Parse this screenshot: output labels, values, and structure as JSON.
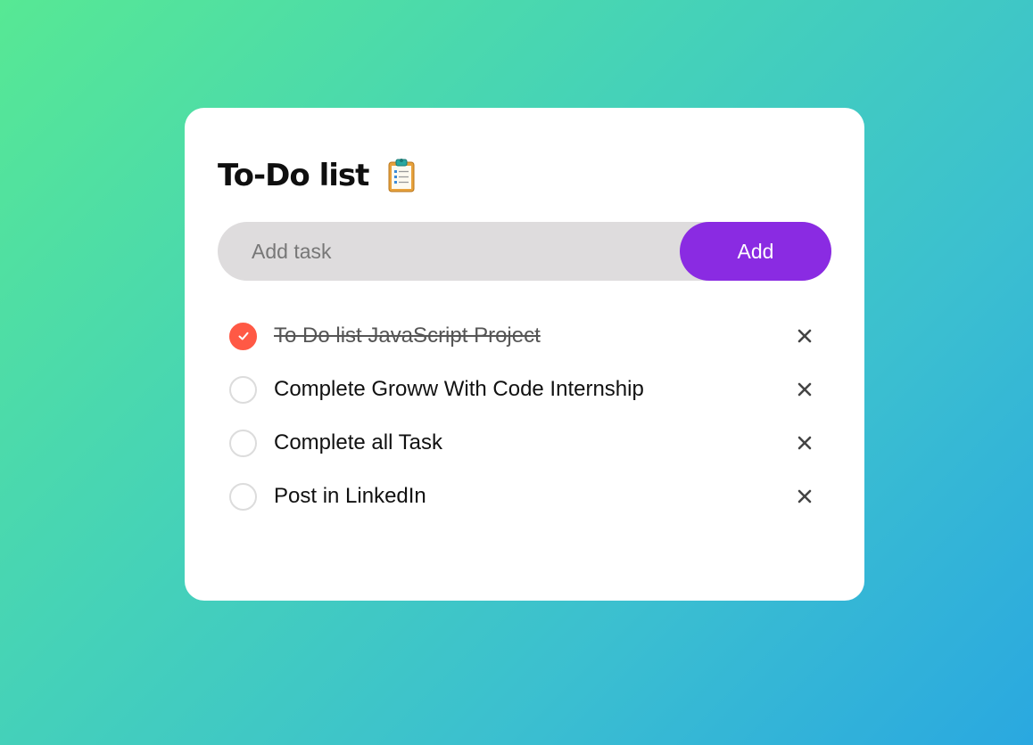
{
  "app": {
    "title": "To-Do list",
    "title_icon": "clipboard-icon"
  },
  "input": {
    "placeholder": "Add task",
    "value": ""
  },
  "add_button": {
    "label": "Add"
  },
  "colors": {
    "accent": "#8a2be2",
    "checked": "#ff5945",
    "input_bg": "#dedcdd"
  },
  "tasks": [
    {
      "text": "To Do list JavaScript Project",
      "done": true
    },
    {
      "text": "Complete Groww With Code Internship",
      "done": false
    },
    {
      "text": "Complete all Task",
      "done": false
    },
    {
      "text": "Post in LinkedIn",
      "done": false
    }
  ],
  "icons": {
    "check": "check-icon",
    "remove": "close-icon"
  }
}
